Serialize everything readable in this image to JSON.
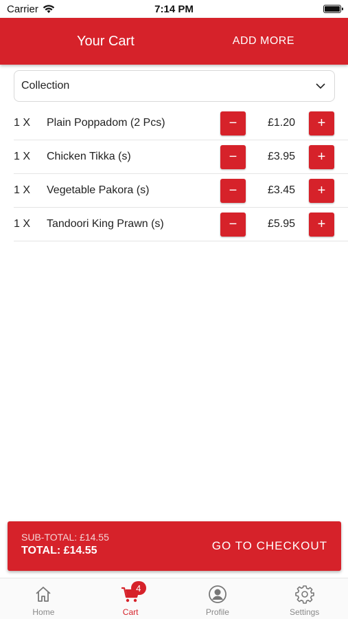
{
  "status_bar": {
    "carrier": "Carrier",
    "time": "7:14 PM"
  },
  "header": {
    "title": "Your Cart",
    "add_more": "ADD MORE"
  },
  "order_type": {
    "selected": "Collection"
  },
  "cart": {
    "items": [
      {
        "qty": "1 X",
        "name": "Plain Poppadom (2 Pcs)",
        "price": "£1.20"
      },
      {
        "qty": "1 X",
        "name": "Chicken Tikka (s)",
        "price": "£3.95"
      },
      {
        "qty": "1 X",
        "name": "Vegetable Pakora (s)",
        "price": "£3.45"
      },
      {
        "qty": "1 X",
        "name": "Tandoori King Prawn (s)",
        "price": "£5.95"
      }
    ],
    "minus_symbol": "−",
    "plus_symbol": "+"
  },
  "summary": {
    "subtotal": "SUB-TOTAL: £14.55",
    "total": "TOTAL: £14.55",
    "checkout": "GO TO CHECKOUT"
  },
  "tabs": [
    {
      "label": "Home",
      "icon": "home-icon"
    },
    {
      "label": "Cart",
      "icon": "cart-icon",
      "badge": "4",
      "active": true
    },
    {
      "label": "Profile",
      "icon": "profile-icon"
    },
    {
      "label": "Settings",
      "icon": "gear-icon"
    }
  ],
  "colors": {
    "brand": "#d6222a"
  }
}
